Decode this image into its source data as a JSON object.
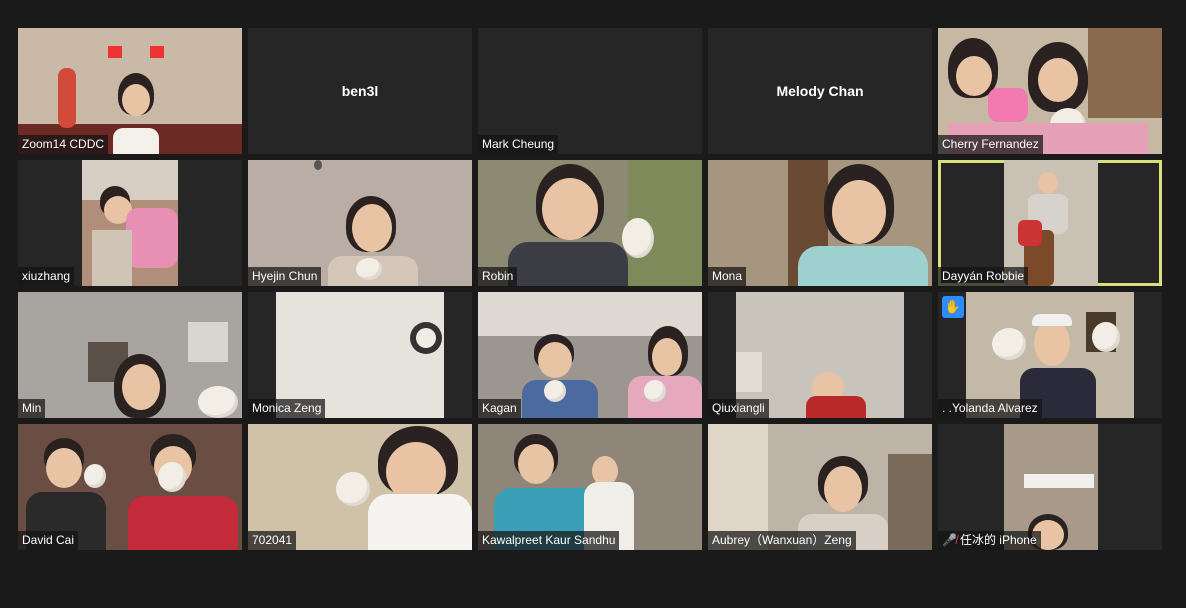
{
  "meeting": {
    "participants": [
      {
        "name": "Zoom14 CDDC",
        "video": true,
        "bg": "#c9b9a6"
      },
      {
        "name": "ben3l",
        "video": false
      },
      {
        "name": "Mark Cheung",
        "video": false,
        "label_only": true
      },
      {
        "name": "Melody Chan",
        "video": false
      },
      {
        "name": "Cherry Fernandez",
        "video": true,
        "bg": "#c7b8a4"
      },
      {
        "name": "xiuzhang",
        "video": true,
        "bg": "#b08e7a"
      },
      {
        "name": "Hyejin Chun",
        "video": true,
        "bg": "#b9ada5"
      },
      {
        "name": "Robin",
        "video": true,
        "bg": "#8d8a74"
      },
      {
        "name": "Mona",
        "video": true,
        "bg": "#a7967f"
      },
      {
        "name": "Dayyán Robbie",
        "video": true,
        "bg": "#c9c2b4",
        "active_speaker": true
      },
      {
        "name": "Min",
        "video": true,
        "bg": "#a8a5a0"
      },
      {
        "name": "Monica Zeng",
        "video": true,
        "bg": "#e6e2dc"
      },
      {
        "name": "Kagan",
        "video": true,
        "bg": "#9c9690"
      },
      {
        "name": "Qiuxiangli",
        "video": true,
        "bg": "#c8c4bc"
      },
      {
        "name": ". .Yolanda Alvarez",
        "video": true,
        "bg": "#c4b9a6",
        "hand_raised": true
      },
      {
        "name": "David Cai",
        "video": true,
        "bg": "#6a4e44"
      },
      {
        "name": "702041",
        "video": true,
        "bg": "#cfc2a8"
      },
      {
        "name": "Kawalpreet Kaur Sandhu",
        "video": true,
        "bg": "#8f8578"
      },
      {
        "name": "Aubrey（Wanxuan）Zeng",
        "video": true,
        "bg": "#bdb3a6"
      },
      {
        "name": "任冰的 iPhone",
        "video": true,
        "bg": "#a79a88",
        "muted": true
      }
    ]
  },
  "colors": {
    "background": "#1a1a1a",
    "tile": "#262626",
    "active_border": "#d8e07a",
    "hand_badge": "#2d8cff",
    "muted": "#e54848"
  },
  "icons": {
    "raised_hand": "raised-hand-icon",
    "muted_mic": "muted-microphone-icon"
  }
}
